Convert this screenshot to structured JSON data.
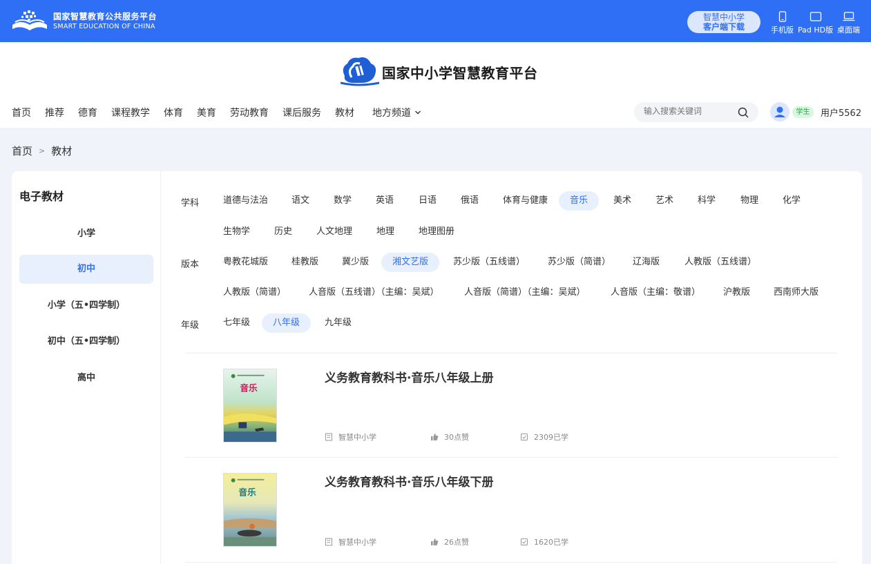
{
  "topbar": {
    "brand_cn": "国家智慧教育公共服务平台",
    "brand_en": "SMART EDUCATION OF CHINA",
    "download_line1": "智慧中小学",
    "download_line2": "客户端下载",
    "devices": [
      "手机版",
      "Pad HD版",
      "桌面端"
    ]
  },
  "header": {
    "site_title": "国家中小学智慧教育平台",
    "nav": [
      "首页",
      "推荐",
      "德育",
      "课程教学",
      "体育",
      "美育",
      "劳动教育",
      "课后服务",
      "教材"
    ],
    "nav_dropdown": "地方频道",
    "search_placeholder": "输入搜索关键词",
    "role": "学生",
    "username": "用户5562"
  },
  "breadcrumb": {
    "home": "首页",
    "current": "教材"
  },
  "sidebar": {
    "title": "电子教材",
    "items": [
      {
        "label": "小学",
        "active": false
      },
      {
        "label": "初中",
        "active": true
      },
      {
        "label": "小学（五•四学制）",
        "active": false
      },
      {
        "label": "初中（五•四学制）",
        "active": false
      },
      {
        "label": "高中",
        "active": false
      }
    ]
  },
  "filters": {
    "subject_label": "学科",
    "subjects": [
      "道德与法治",
      "语文",
      "数学",
      "英语",
      "日语",
      "俄语",
      "体育与健康",
      "音乐",
      "美术",
      "艺术",
      "科学",
      "物理",
      "化学",
      "生物学",
      "历史",
      "人文地理",
      "地理",
      "地理图册"
    ],
    "subject_selected": "音乐",
    "edition_label": "版本",
    "editions": [
      "粤教花城版",
      "桂教版",
      "冀少版",
      "湘文艺版",
      "苏少版（五线谱）",
      "苏少版（简谱）",
      "辽海版",
      "人教版（五线谱）",
      "人教版（简谱）",
      "人音版（五线谱）（主编：吴斌）",
      "人音版（简谱）（主编：吴斌）",
      "人音版（主编：敬谱）",
      "沪教版",
      "西南师大版"
    ],
    "edition_selected": "湘文艺版",
    "grade_label": "年级",
    "grades": [
      "七年级",
      "八年级",
      "九年级"
    ],
    "grade_selected": "八年级"
  },
  "books": [
    {
      "title": "义务教育教科书·音乐八年级上册",
      "source": "智慧中小学",
      "likes": "30点赞",
      "learners": "2309已学",
      "cover_text": "音乐"
    },
    {
      "title": "义务教育教科书·音乐八年级下册",
      "source": "智慧中小学",
      "likes": "26点赞",
      "learners": "1620已学",
      "cover_text": "音乐"
    }
  ],
  "colors": {
    "brand_blue": "#2f6ff6",
    "active_bg": "#e8effd",
    "page_bg": "#f0f3f9"
  }
}
